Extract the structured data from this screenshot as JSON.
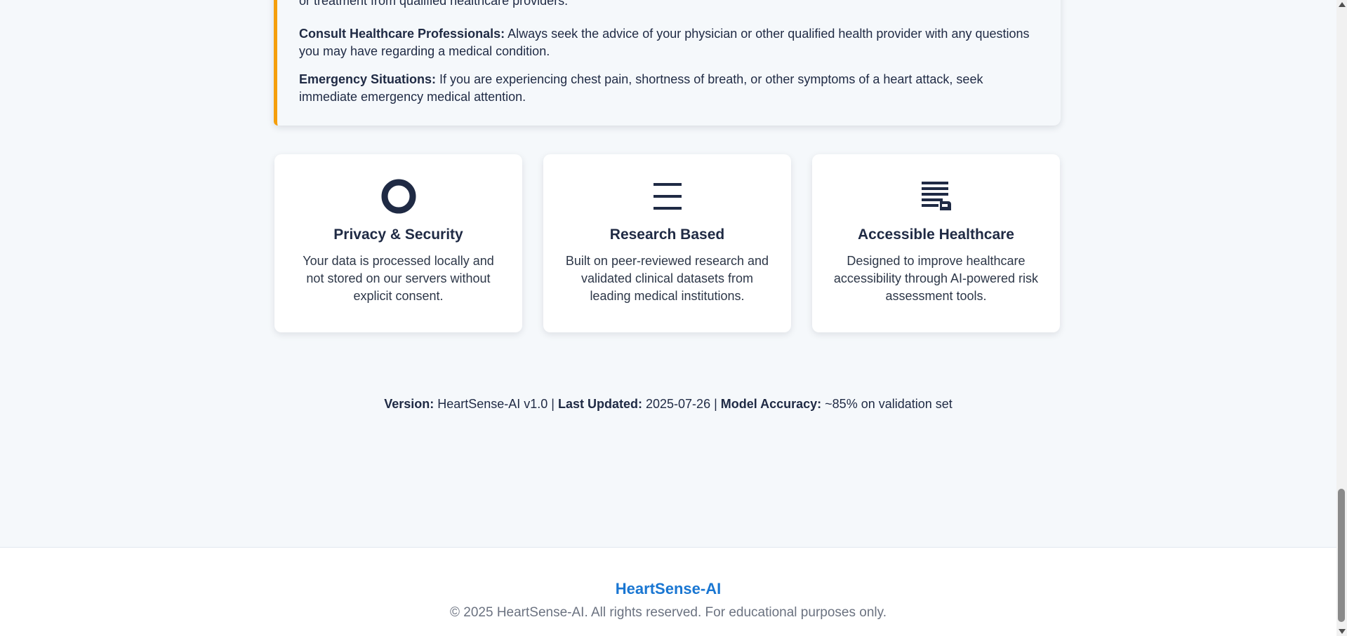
{
  "disclaimer": {
    "cut_line": "or treatment from qualified healthcare providers.",
    "consult_label": "Consult Healthcare Professionals:",
    "consult_text": " Always seek the advice of your physician or other qualified health provider with any questions you may have regarding a medical condition.",
    "emergency_label": "Emergency Situations:",
    "emergency_text": " If you are experiencing chest pain, shortness of breath, or other symptoms of a heart attack, seek immediate emergency medical attention.",
    "accent_color": "#f59e0b"
  },
  "features": [
    {
      "icon": "circle-icon",
      "title": "Privacy & Security",
      "text": "Your data is processed locally and not stored on our servers without explicit consent."
    },
    {
      "icon": "lines-icon",
      "title": "Research Based",
      "text": "Built on peer-reviewed research and validated clinical datasets from leading medical institutions."
    },
    {
      "icon": "document-icon",
      "title": "Accessible Healthcare",
      "text": "Designed to improve healthcare accessibility through AI-powered risk assessment tools."
    }
  ],
  "meta": {
    "version_label": "Version:",
    "version_value": " HeartSense-AI v1.0 | ",
    "updated_label": "Last Updated:",
    "updated_value": " 2025-07-26 | ",
    "accuracy_label": "Model Accuracy:",
    "accuracy_value": " ~85% on validation set"
  },
  "footer": {
    "brand": "HeartSense-AI",
    "copyright": "© 2025 HeartSense-AI. All rights reserved. For educational purposes only.",
    "brand_color": "#1976d2"
  }
}
